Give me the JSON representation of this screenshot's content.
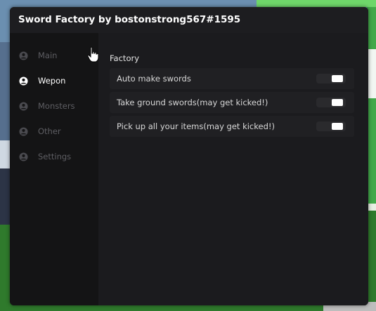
{
  "window": {
    "title": "Sword Factory by bostonstrong567#1595"
  },
  "sidebar": {
    "items": [
      {
        "label": "Main",
        "icon": "user-circle-icon",
        "active": false
      },
      {
        "label": "Wepon",
        "icon": "user-circle-icon",
        "active": true
      },
      {
        "label": "Monsters",
        "icon": "user-circle-icon",
        "active": false
      },
      {
        "label": "Other",
        "icon": "user-circle-icon",
        "active": false
      },
      {
        "label": "Settings",
        "icon": "user-circle-icon",
        "active": false
      }
    ]
  },
  "content": {
    "section_title": "Factory",
    "toggles": [
      {
        "label": "Auto make swords",
        "enabled": false
      },
      {
        "label": "Take ground swords(may get kicked!)",
        "enabled": false
      },
      {
        "label": "Pick up all your items(may get kicked!)",
        "enabled": false
      }
    ]
  },
  "colors": {
    "window_bg": "#1b1b1e",
    "sidebar_bg": "#141415",
    "active_text": "#ffffff",
    "inactive_text": "#5e5e63",
    "row_bg": "#202023"
  }
}
